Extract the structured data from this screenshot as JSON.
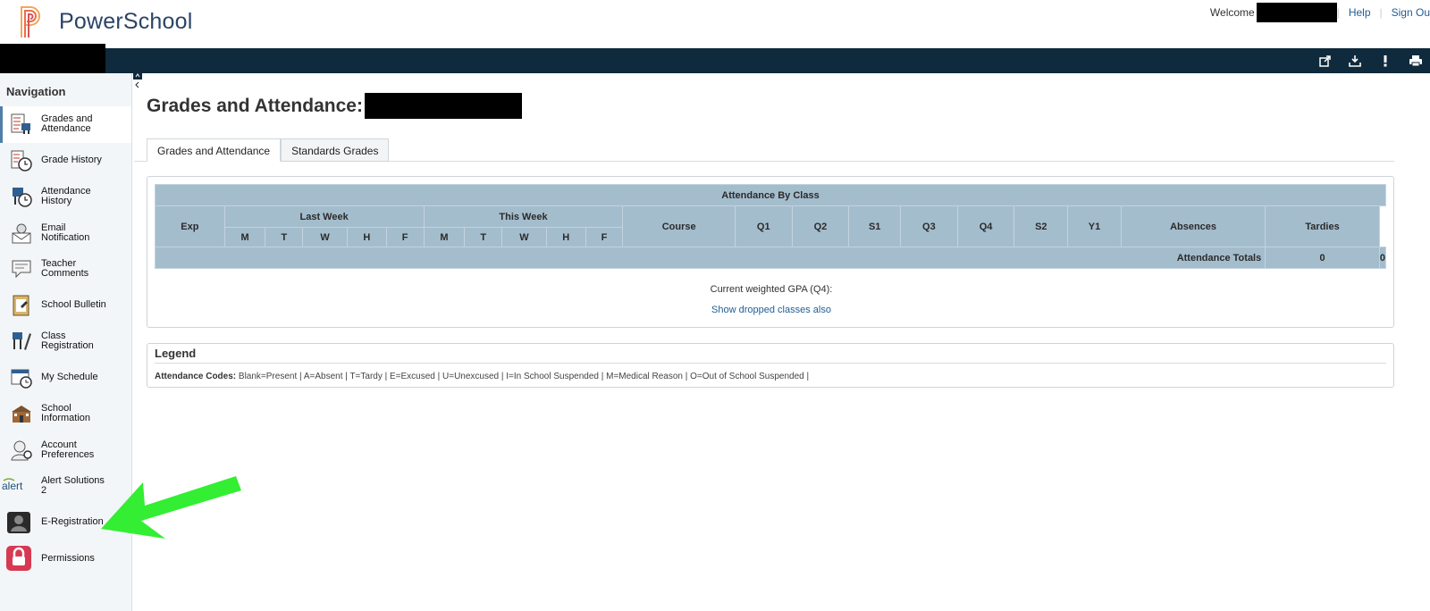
{
  "header": {
    "brand": "PowerSchool",
    "welcome": "Welcome",
    "links": [
      "Help",
      "Sign Ou"
    ]
  },
  "topbar_icons": [
    "external-link-icon",
    "download-icon",
    "alert-icon",
    "print-icon"
  ],
  "navigation": {
    "title": "Navigation",
    "items": [
      {
        "label": "Grades and Attendance",
        "icon": "grades-icon",
        "active": true
      },
      {
        "label": "Grade History",
        "icon": "grade-history-icon"
      },
      {
        "label": "Attendance History",
        "icon": "attendance-history-icon"
      },
      {
        "label": "Email Notification",
        "icon": "email-icon"
      },
      {
        "label": "Teacher Comments",
        "icon": "comments-icon"
      },
      {
        "label": "School Bulletin",
        "icon": "bulletin-icon"
      },
      {
        "label": "Class Registration",
        "icon": "registration-icon"
      },
      {
        "label": "My Schedule",
        "icon": "schedule-icon"
      },
      {
        "label": "School Information",
        "icon": "school-icon"
      },
      {
        "label": "Account Preferences",
        "icon": "account-icon"
      },
      {
        "label": "Alert Solutions 2",
        "icon": "alert-logo-icon"
      },
      {
        "label": "E-Registration",
        "icon": "e-registration-icon"
      },
      {
        "label": "Permissions",
        "icon": "lock-icon"
      }
    ]
  },
  "page": {
    "title": "Grades and Attendance:",
    "tabs": [
      "Grades and Attendance",
      "Standards Grades"
    ]
  },
  "attendance_table": {
    "caption": "Attendance By Class",
    "headers": {
      "exp": "Exp",
      "last_week": "Last Week",
      "this_week": "This Week",
      "course": "Course",
      "terms": [
        "Q1",
        "Q2",
        "S1",
        "Q3",
        "Q4",
        "S2",
        "Y1"
      ],
      "absences": "Absences",
      "tardies": "Tardies"
    },
    "days": [
      "M",
      "T",
      "W",
      "H",
      "F"
    ],
    "totals": {
      "label": "Attendance Totals",
      "absences": "0",
      "tardies": "0"
    },
    "gpa_label": "Current weighted GPA (Q4):",
    "dropped_link": "Show dropped classes also"
  },
  "legend": {
    "title": "Legend",
    "codes_label": "Attendance Codes:",
    "codes_text": "Blank=Present | A=Absent | T=Tardy | E=Excused | U=Unexcused | I=In School Suspended | M=Medical Reason | O=Out of School Suspended |"
  },
  "colors": {
    "topbar": "#0f2a3c",
    "table_header": "#a4bdcd",
    "link": "#1f5d95",
    "arrow": "#33ee33"
  }
}
